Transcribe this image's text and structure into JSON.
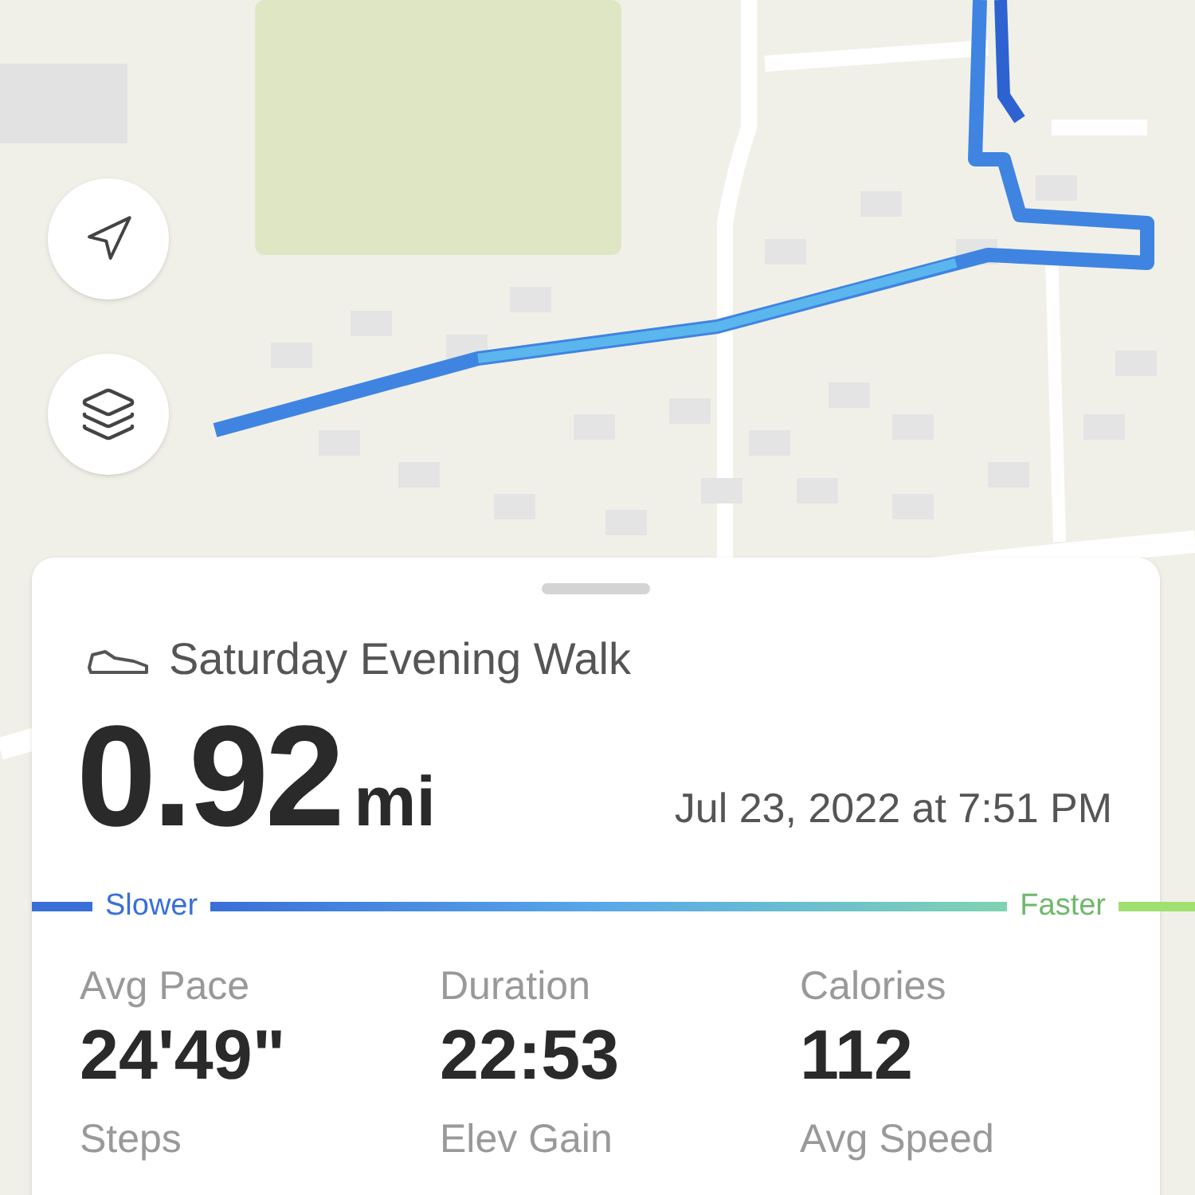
{
  "map_buttons": [
    {
      "kind": "locate"
    },
    {
      "kind": "layers"
    }
  ],
  "activity": {
    "title": "Saturday Evening Walk",
    "distance": "0.92",
    "unit": "mi",
    "date": "Jul 23, 2022 at 7:51 PM"
  },
  "pace_legend": {
    "slower": "Slower",
    "faster": "Faster"
  },
  "stats": [
    {
      "label": "Avg Pace",
      "value": "24'49\""
    },
    {
      "label": "Duration",
      "value": "22:53"
    },
    {
      "label": "Calories",
      "value": "112"
    },
    {
      "label": "Steps"
    },
    {
      "label": "Elev Gain"
    },
    {
      "label": "Avg Speed"
    }
  ]
}
